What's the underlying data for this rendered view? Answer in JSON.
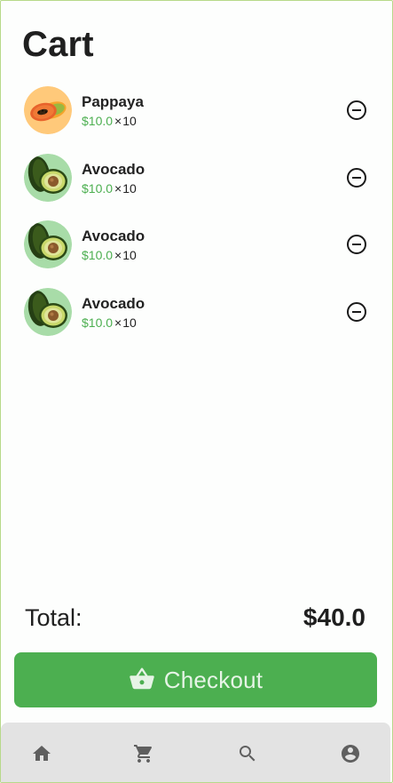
{
  "page": {
    "title": "Cart"
  },
  "cart": {
    "items": [
      {
        "name": "Pappaya",
        "price": "$10.0",
        "times": "×",
        "qty": "10",
        "image": "papaya-image"
      },
      {
        "name": "Avocado",
        "price": "$10.0",
        "times": "×",
        "qty": "10",
        "image": "avocado-image"
      },
      {
        "name": "Avocado",
        "price": "$10.0",
        "times": "×",
        "qty": "10",
        "image": "avocado-image"
      },
      {
        "name": "Avocado",
        "price": "$10.0",
        "times": "×",
        "qty": "10",
        "image": "avocado-image"
      }
    ],
    "remove_icon": "remove-circle-outline-icon"
  },
  "summary": {
    "total_label": "Total:",
    "total_value": "$40.0"
  },
  "checkout": {
    "label": "Checkout",
    "icon": "shopping-basket-icon"
  },
  "nav": {
    "items": [
      {
        "name": "home",
        "icon": "home-icon"
      },
      {
        "name": "cart",
        "icon": "shopping-cart-icon"
      },
      {
        "name": "search",
        "icon": "search-icon"
      },
      {
        "name": "account",
        "icon": "account-circle-icon"
      }
    ]
  },
  "colors": {
    "accent": "#4caf50",
    "nav_bg": "#e3e3e3",
    "nav_icon": "#5f5f5f",
    "background": "#fdfefd"
  }
}
